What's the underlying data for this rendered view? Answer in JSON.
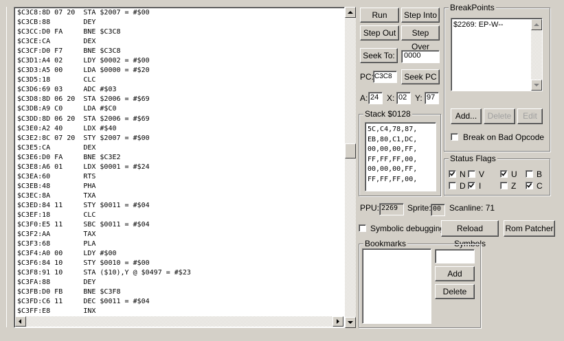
{
  "disassembly": {
    "lines": [
      "$C3C8:8D 07 20  STA $2007 = #$00",
      "$C3CB:88        DEY",
      "$C3CC:D0 FA     BNE $C3C8",
      "$C3CE:CA        DEX",
      "$C3CF:D0 F7     BNE $C3C8",
      "$C3D1:A4 02     LDY $0002 = #$00",
      "$C3D3:A5 00     LDA $0000 = #$20",
      "$C3D5:18        CLC",
      "$C3D6:69 03     ADC #$03",
      "$C3D8:8D 06 20  STA $2006 = #$69",
      "$C3DB:A9 C0     LDA #$C0",
      "$C3DD:8D 06 20  STA $2006 = #$69",
      "$C3E0:A2 40     LDX #$40",
      "$C3E2:8C 07 20  STY $2007 = #$00",
      "$C3E5:CA        DEX",
      "$C3E6:D0 FA     BNE $C3E2",
      "$C3E8:A6 01     LDX $0001 = #$24",
      "$C3EA:60        RTS",
      "$C3EB:48        PHA",
      "$C3EC:8A        TXA",
      "$C3ED:84 11     STY $0011 = #$04",
      "$C3EF:18        CLC",
      "$C3F0:E5 11     SBC $0011 = #$04",
      "$C3F2:AA        TAX",
      "$C3F3:68        PLA",
      "$C3F4:A0 00     LDY #$00",
      "$C3F6:84 10     STY $0010 = #$00",
      "$C3F8:91 10     STA ($10),Y @ $0497 = #$23",
      "$C3FA:88        DEY",
      "$C3FB:D0 FB     BNE $C3F8",
      "$C3FD:C6 11     DEC $0011 = #$04",
      "$C3FF:E8        INX"
    ]
  },
  "controls": {
    "run": "Run",
    "step_into": "Step Into",
    "step_out": "Step Out",
    "step_over": "Step Over",
    "seek_to": "Seek To:",
    "seek_to_value": "0000",
    "pc_label": "PC:",
    "pc_value": "C3C8",
    "seek_pc": "Seek PC"
  },
  "registers": {
    "a_label": "A:",
    "a_value": "24",
    "x_label": "X:",
    "x_value": "02",
    "y_label": "Y:",
    "y_value": "97"
  },
  "stack": {
    "title": "Stack $0128",
    "lines": [
      "5C,C4,78,87,",
      "EB,80,C1,DC,",
      "00,00,00,FF,",
      "FF,FF,FF,00,",
      "00,00,00,FF,",
      "FF,FF,FF,00,"
    ]
  },
  "breakpoints": {
    "title": "BreakPoints",
    "items": [
      "$2269: EP-W--"
    ],
    "add": "Add...",
    "delete": "Delete",
    "edit": "Edit",
    "break_bad_opcode": "Break on Bad Opcode"
  },
  "status_flags": {
    "title": "Status Flags",
    "flags": [
      {
        "name": "N",
        "checked": true
      },
      {
        "name": "V",
        "checked": false
      },
      {
        "name": "U",
        "checked": true
      },
      {
        "name": "B",
        "checked": false
      },
      {
        "name": "D",
        "checked": false
      },
      {
        "name": "I",
        "checked": true
      },
      {
        "name": "Z",
        "checked": false
      },
      {
        "name": "C",
        "checked": true
      }
    ]
  },
  "ppu": {
    "ppu_label": "PPU:",
    "ppu_value": "2269",
    "sprite_label": "Sprite:",
    "sprite_value": "00",
    "scanline_text": "Scanline: 71"
  },
  "options": {
    "symbolic_debugging": "Symbolic debugging",
    "reload_symbols": "Reload Symbols",
    "rom_patcher": "Rom Patcher"
  },
  "bookmarks": {
    "title": "Bookmarks",
    "add": "Add",
    "delete": "Delete"
  }
}
